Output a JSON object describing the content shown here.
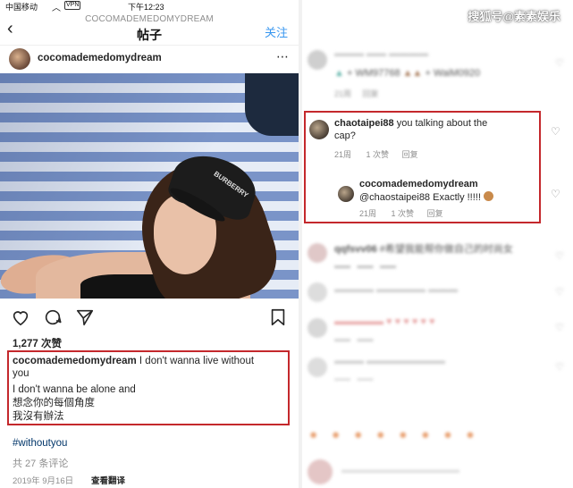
{
  "status_bar": {
    "carrier": "中国移动",
    "network": "VPN",
    "time": "下午12:23"
  },
  "nav": {
    "back_icon": "chevron-left-icon",
    "subtitle": "COCOMADEMEDOMYDREAM",
    "title": "帖子",
    "follow_label": "关注"
  },
  "post": {
    "username": "cocomademedomydream",
    "likes": "1,277 次赞",
    "caption_username": "cocomademedomydream",
    "caption_lines": [
      "I don't wanna live without",
      "you",
      "I don't wanna be alone and",
      "想念你的每個角度",
      "我沒有辦法"
    ],
    "hashtag": "#withoutyou",
    "comments_count": "共 27 条评论",
    "date": "2019年 9月16日",
    "translate_label": "查看翻译"
  },
  "watermark": "搜狐号@素素娱乐",
  "comments": [
    {
      "text": "WM97768",
      "text2": "WaiM0920",
      "time": "21周",
      "reply": "回复"
    },
    {
      "username": "chaotaipei88",
      "text": "you talking about the",
      "text2": "cap?",
      "time": "21周",
      "likes": "1 次赞",
      "reply": "回复",
      "reply_thread": {
        "username": "cocomademedomydream",
        "text": "@chaostaipei88 Exactly !!!!!",
        "time": "21周",
        "likes": "1 次赞",
        "reply": "回复"
      }
    },
    {
      "username": "qqfsvv06",
      "text": "#希望我能帮你做自己的时尚女"
    }
  ],
  "colors": {
    "highlight_border": "#c4282c",
    "link_blue": "#3897f0",
    "hashtag_color": "#003569"
  }
}
